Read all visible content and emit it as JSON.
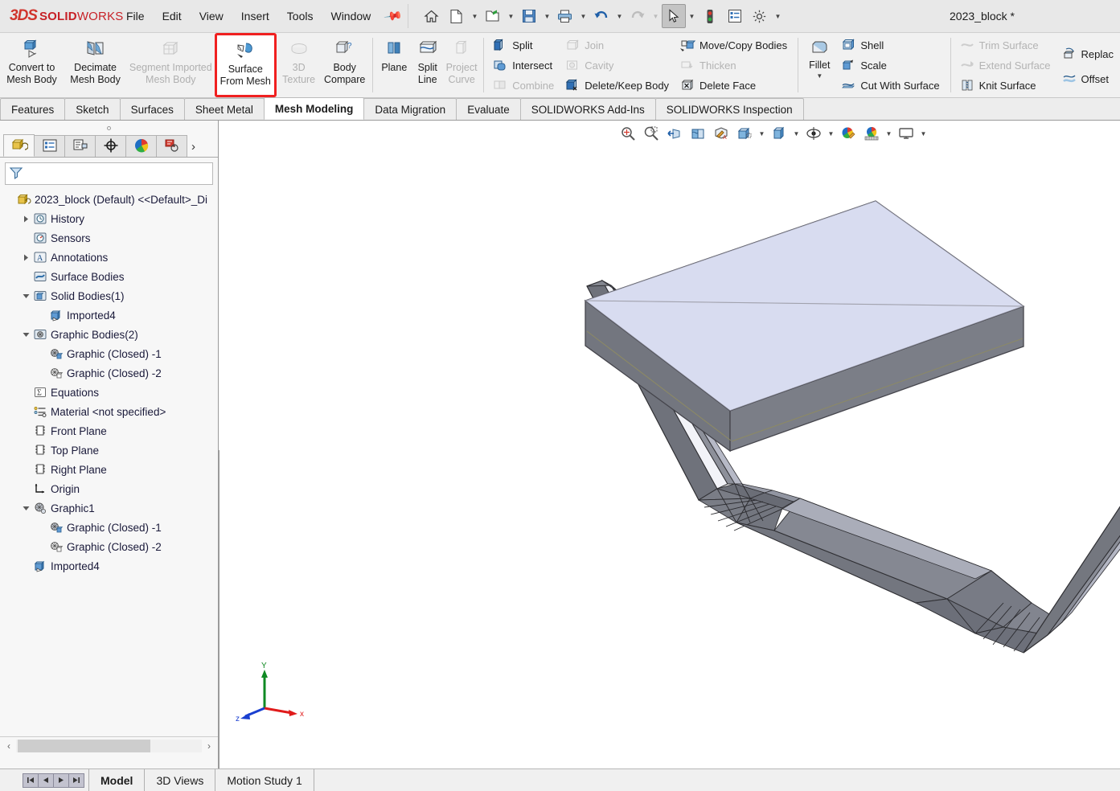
{
  "app": {
    "brand_3ds": "3DS",
    "brand_name": "SOLIDWORKS",
    "brand_light": "WORKS",
    "document_title": "2023_block *",
    "accent_red": "#c72127",
    "highlight_red": "#f02020"
  },
  "menu": {
    "items": [
      {
        "label": "File",
        "name": "menu-file"
      },
      {
        "label": "Edit",
        "name": "menu-edit"
      },
      {
        "label": "View",
        "name": "menu-view"
      },
      {
        "label": "Insert",
        "name": "menu-insert"
      },
      {
        "label": "Tools",
        "name": "menu-tools"
      },
      {
        "label": "Window",
        "name": "menu-window"
      }
    ],
    "pin_icon": "pin-icon"
  },
  "quick_access": [
    {
      "name": "home-icon",
      "caret": false
    },
    {
      "name": "new-document-icon",
      "caret": true
    },
    {
      "name": "open-folder-icon",
      "caret": true
    },
    {
      "name": "save-icon",
      "caret": true
    },
    {
      "name": "print-icon",
      "caret": true
    },
    {
      "name": "undo-icon",
      "caret": true
    },
    {
      "name": "redo-icon",
      "caret": true,
      "disabled": true
    },
    {
      "name": "select-cursor-icon",
      "caret": true,
      "active": true
    },
    {
      "name": "rebuild-traffic-light-icon",
      "caret": false
    },
    {
      "name": "options-list-icon",
      "caret": false
    },
    {
      "name": "settings-gear-icon",
      "caret": true
    }
  ],
  "ribbon": {
    "big_buttons": [
      {
        "label_line1": "Convert to",
        "label_line2": "Mesh Body",
        "name": "convert-to-mesh-body-button",
        "icon": "convert-mesh-icon",
        "state": "enabled"
      },
      {
        "label_line1": "Decimate",
        "label_line2": "Mesh Body",
        "name": "decimate-mesh-body-button",
        "icon": "decimate-mesh-icon",
        "state": "enabled"
      },
      {
        "label_line1": "Segment Imported",
        "label_line2": "Mesh Body",
        "name": "segment-imported-mesh-body-button",
        "icon": "segment-mesh-icon",
        "state": "disabled"
      },
      {
        "label_line1": "Surface",
        "label_line2": "From Mesh",
        "name": "surface-from-mesh-button",
        "icon": "surface-from-mesh-icon",
        "state": "highlighted"
      },
      {
        "label_line1": "3D",
        "label_line2": "Texture",
        "name": "3d-texture-button",
        "icon": "3d-texture-icon",
        "state": "disabled"
      },
      {
        "label_line1": "Body",
        "label_line2": "Compare",
        "name": "body-compare-button",
        "icon": "body-compare-icon",
        "state": "enabled"
      },
      {
        "label_line1": "Plane",
        "label_line2": "",
        "name": "plane-button",
        "icon": "plane-icon",
        "state": "enabled"
      },
      {
        "label_line1": "Split",
        "label_line2": "Line",
        "name": "split-line-button",
        "icon": "split-line-icon",
        "state": "enabled"
      },
      {
        "label_line1": "Project",
        "label_line2": "Curve",
        "name": "project-curve-button",
        "icon": "project-curve-icon",
        "state": "disabled"
      }
    ],
    "col_split": [
      {
        "label": "Split",
        "name": "split-button",
        "icon": "split-icon",
        "state": "enabled"
      },
      {
        "label": "Intersect",
        "name": "intersect-button",
        "icon": "intersect-icon",
        "state": "enabled"
      },
      {
        "label": "Combine",
        "name": "combine-button",
        "icon": "combine-icon",
        "state": "disabled"
      }
    ],
    "col_join": [
      {
        "label": "Join",
        "name": "join-button",
        "icon": "join-icon",
        "state": "disabled"
      },
      {
        "label": "Cavity",
        "name": "cavity-button",
        "icon": "cavity-icon",
        "state": "disabled"
      },
      {
        "label": "Delete/Keep Body",
        "name": "delete-keep-body-button",
        "icon": "delete-keep-body-icon",
        "state": "enabled"
      }
    ],
    "col_move": [
      {
        "label": "Move/Copy Bodies",
        "name": "move-copy-bodies-button",
        "icon": "move-copy-bodies-icon",
        "state": "enabled"
      },
      {
        "label": "Thicken",
        "name": "thicken-button",
        "icon": "thicken-icon",
        "state": "disabled"
      },
      {
        "label": "Delete Face",
        "name": "delete-face-button",
        "icon": "delete-face-icon",
        "state": "enabled"
      }
    ],
    "fillet": {
      "label": "Fillet",
      "name": "fillet-button",
      "icon": "fillet-icon"
    },
    "col_shell": [
      {
        "label": "Shell",
        "name": "shell-button",
        "icon": "shell-icon",
        "state": "enabled"
      },
      {
        "label": "Scale",
        "name": "scale-button",
        "icon": "scale-icon",
        "state": "enabled"
      },
      {
        "label": "Cut With Surface",
        "name": "cut-with-surface-button",
        "icon": "cut-with-surface-icon",
        "state": "enabled"
      }
    ],
    "col_trim": [
      {
        "label": "Trim Surface",
        "name": "trim-surface-button",
        "icon": "trim-surface-icon",
        "state": "disabled"
      },
      {
        "label": "Extend Surface",
        "name": "extend-surface-button",
        "icon": "extend-surface-icon",
        "state": "disabled"
      },
      {
        "label": "Knit Surface",
        "name": "knit-surface-button",
        "icon": "knit-surface-icon",
        "state": "enabled"
      }
    ],
    "col_replace": [
      {
        "label": "Replac",
        "name": "replace-face-button",
        "icon": "replace-face-icon",
        "state": "enabled"
      },
      {
        "label": "Offset",
        "name": "offset-surface-button",
        "icon": "offset-surface-icon",
        "state": "enabled"
      }
    ]
  },
  "command_tabs": [
    {
      "label": "Features",
      "name": "tab-features",
      "active": false
    },
    {
      "label": "Sketch",
      "name": "tab-sketch",
      "active": false
    },
    {
      "label": "Surfaces",
      "name": "tab-surfaces",
      "active": false
    },
    {
      "label": "Sheet Metal",
      "name": "tab-sheet-metal",
      "active": false
    },
    {
      "label": "Mesh Modeling",
      "name": "tab-mesh-modeling",
      "active": true
    },
    {
      "label": "Data Migration",
      "name": "tab-data-migration",
      "active": false
    },
    {
      "label": "Evaluate",
      "name": "tab-evaluate",
      "active": false
    },
    {
      "label": "SOLIDWORKS Add-Ins",
      "name": "tab-solidworks-add-ins",
      "active": false
    },
    {
      "label": "SOLIDWORKS Inspection",
      "name": "tab-solidworks-inspection",
      "active": false
    }
  ],
  "left_panel": {
    "tabs": [
      {
        "name": "tab-feature-manager",
        "icon": "feature-manager-tree-icon",
        "active": true
      },
      {
        "name": "tab-property-manager",
        "icon": "property-manager-icon",
        "active": false
      },
      {
        "name": "tab-configuration-manager",
        "icon": "configuration-manager-icon",
        "active": false
      },
      {
        "name": "tab-dimxpert-manager",
        "icon": "dimxpert-manager-icon",
        "active": false
      },
      {
        "name": "tab-display-manager",
        "icon": "display-manager-icon",
        "active": false
      },
      {
        "name": "tab-appearance-manager",
        "icon": "appearance-callout-icon",
        "active": false
      }
    ],
    "more_icon": "chevron-right-icon",
    "filter": {
      "placeholder": "",
      "value": "",
      "icon": "filter-funnel-icon"
    },
    "tree": [
      {
        "label": "2023_block (Default) <<Default>_Di",
        "indent": 0,
        "twist": "none",
        "icon": "part-document-icon",
        "name": "tree-item-part-root"
      },
      {
        "label": "History",
        "indent": 1,
        "twist": "collapsed",
        "icon": "history-icon",
        "name": "tree-item-history"
      },
      {
        "label": "Sensors",
        "indent": 1,
        "twist": "none",
        "icon": "sensors-icon",
        "name": "tree-item-sensors"
      },
      {
        "label": "Annotations",
        "indent": 1,
        "twist": "collapsed",
        "icon": "annotations-icon",
        "name": "tree-item-annotations"
      },
      {
        "label": "Surface Bodies",
        "indent": 1,
        "twist": "none",
        "icon": "surface-bodies-icon",
        "name": "tree-item-surface-bodies"
      },
      {
        "label": "Solid Bodies(1)",
        "indent": 1,
        "twist": "expanded",
        "icon": "solid-bodies-icon",
        "name": "tree-item-solid-bodies"
      },
      {
        "label": "Imported4",
        "indent": 2,
        "twist": "none",
        "icon": "imported-body-icon",
        "name": "tree-item-imported4-solid"
      },
      {
        "label": "Graphic Bodies(2)",
        "indent": 1,
        "twist": "expanded",
        "icon": "graphic-bodies-icon",
        "name": "tree-item-graphic-bodies"
      },
      {
        "label": "Graphic (Closed) -1",
        "indent": 2,
        "twist": "none",
        "icon": "graphic-closed-icon",
        "name": "tree-item-graphic-closed-1"
      },
      {
        "label": "Graphic (Closed) -2",
        "indent": 2,
        "twist": "none",
        "icon": "graphic-closed-outline-icon",
        "name": "tree-item-graphic-closed-2"
      },
      {
        "label": "Equations",
        "indent": 1,
        "twist": "none",
        "icon": "equations-icon",
        "name": "tree-item-equations"
      },
      {
        "label": "Material <not specified>",
        "indent": 1,
        "twist": "none",
        "icon": "material-icon",
        "name": "tree-item-material"
      },
      {
        "label": "Front Plane",
        "indent": 1,
        "twist": "none",
        "icon": "plane-icon",
        "name": "tree-item-front-plane"
      },
      {
        "label": "Top Plane",
        "indent": 1,
        "twist": "none",
        "icon": "plane-icon",
        "name": "tree-item-top-plane"
      },
      {
        "label": "Right Plane",
        "indent": 1,
        "twist": "none",
        "icon": "plane-icon",
        "name": "tree-item-right-plane"
      },
      {
        "label": "Origin",
        "indent": 1,
        "twist": "none",
        "icon": "origin-icon",
        "name": "tree-item-origin"
      },
      {
        "label": "Graphic1",
        "indent": 1,
        "twist": "expanded",
        "icon": "graphic-feature-icon",
        "name": "tree-item-graphic1"
      },
      {
        "label": "Graphic (Closed) -1",
        "indent": 2,
        "twist": "none",
        "icon": "graphic-closed-icon",
        "name": "tree-item-graphic1-closed-1"
      },
      {
        "label": "Graphic (Closed) -2",
        "indent": 2,
        "twist": "none",
        "icon": "graphic-closed-outline-icon",
        "name": "tree-item-graphic1-closed-2"
      },
      {
        "label": "Imported4",
        "indent": 1,
        "twist": "none",
        "icon": "imported-body-icon",
        "name": "tree-item-imported4-feature"
      }
    ],
    "scroll": {
      "left_arrow": "‹",
      "right_arrow": "›"
    }
  },
  "view_toolbar": [
    {
      "name": "zoom-to-fit-icon",
      "caret": false
    },
    {
      "name": "zoom-to-area-icon",
      "caret": false
    },
    {
      "name": "previous-view-icon",
      "caret": false
    },
    {
      "name": "section-view-icon",
      "caret": false
    },
    {
      "name": "view-orientation-paint-icon",
      "caret": false
    },
    {
      "name": "display-style-icon",
      "caret": true
    },
    {
      "name": "view-orientation-cube-icon",
      "caret": true
    },
    {
      "name": "hide-show-items-icon",
      "caret": true
    },
    {
      "name": "edit-appearance-icon",
      "caret": false
    },
    {
      "name": "apply-scene-icon",
      "caret": true
    },
    {
      "name": "view-settings-display-icon",
      "caret": true
    }
  ],
  "graphics": {
    "background": "#ffffff",
    "plate_top_color": "#d6dbf0",
    "plate_side_color": "#73767f",
    "bracket_color": "#72757e",
    "bracket_light_color": "#b9bcc9",
    "edge_color": "#3a3a3a",
    "triad": {
      "x_label": "x",
      "y_label": "Y",
      "z_label": "z",
      "x_color": "#e01b1b",
      "y_color": "#0f8a23",
      "z_color": "#1a3fd0"
    }
  },
  "bottom_bar": {
    "nav_buttons": [
      {
        "name": "first-config-button",
        "glyph": "❘◀"
      },
      {
        "name": "previous-config-button",
        "glyph": "◀"
      },
      {
        "name": "next-config-button",
        "glyph": "▶"
      },
      {
        "name": "last-config-button",
        "glyph": "▶❘"
      }
    ],
    "tabs": [
      {
        "label": "Model",
        "name": "doc-tab-model",
        "active": true
      },
      {
        "label": "3D Views",
        "name": "doc-tab-3d-views",
        "active": false
      },
      {
        "label": "Motion Study 1",
        "name": "doc-tab-motion-study-1",
        "active": false
      }
    ]
  }
}
